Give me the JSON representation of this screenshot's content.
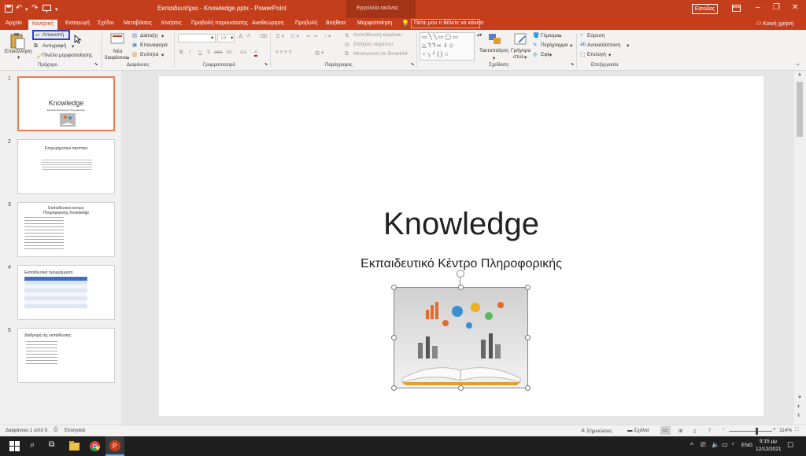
{
  "titlebar": {
    "title": "Εκπαιδευτήριο - Knowledge.pptx - PowerPoint",
    "context": "Εργαλεία εικόνας",
    "signin": "Είσοδος",
    "save_icon": "save-icon",
    "undo_icon": "undo-icon",
    "redo_icon": "redo-icon",
    "present_icon": "present-icon"
  },
  "tabs": {
    "file": "Αρχείο",
    "home": "Κεντρική",
    "insert": "Εισαγωγή",
    "design": "Σχέδιο",
    "transitions": "Μεταβάσεις",
    "animations": "Κινήσεις",
    "slideshow": "Προβολή παρουσίασης",
    "review": "Αναθεώρηση",
    "view": "Προβολή",
    "help": "Βοήθεια",
    "format": "Μορφοποίηση",
    "tellme": "Πείτε μου τι θέλετε να κάνετε",
    "share": "Κοινή χρήση"
  },
  "ribbon": {
    "clipboard": {
      "paste": "Επικόλληση",
      "cut": "Αποκοπή",
      "copy": "Αντιγραφή",
      "format_painter": "Πινέλο μορφοποίησης",
      "label": "Πρόχειρο"
    },
    "slides": {
      "new_slide_1": "Νέα",
      "new_slide_2": "διαφάνεια",
      "layout": "Διάταξη",
      "reset": "Επαναφορά",
      "section": "Ενότητα",
      "label": "Διαφάνειες"
    },
    "font": {
      "size": "18",
      "label": "Γραμματοσειρά",
      "bold": "B",
      "italic": "I",
      "underline": "U",
      "shadow": "S",
      "strike": "abc",
      "spacing": "AV",
      "case": "Aa",
      "font_color": "A",
      "grow": "A",
      "shrink": "A"
    },
    "paragraph": {
      "text_direction": "Κατεύθυνση κειμένου",
      "align_text": "Στοίχιση κειμένου",
      "smartart": "Μετατροπή σε SmartArt",
      "label": "Παράγραφος"
    },
    "drawing": {
      "arrange": "Τακτοποίηση",
      "quick_styles_1": "Γρήγορα",
      "quick_styles_2": "στυλ",
      "fill": "Γέμισμα",
      "outline": "Περίγραμμα",
      "effects": "Εφέ",
      "label": "Σχεδίαση"
    },
    "editing": {
      "find": "Εύρεση",
      "replace": "Αντικατάσταση",
      "select": "Επιλογή",
      "label": "Επεξεργασία"
    }
  },
  "thumbnails": [
    {
      "num": "1",
      "title": "Knowledge",
      "subtitle": "Εκπαιδευτικό Κέντρο Πληροφορικής"
    },
    {
      "num": "2",
      "title": "Επιχειρηματικό σκεπτικό"
    },
    {
      "num": "3",
      "title": "Εκπαιδευτικό κέντρο",
      "title2": "Πληροφορικής Knowledge"
    },
    {
      "num": "4",
      "title": "Εκπαιδευτικά προγράμματα"
    },
    {
      "num": "5",
      "title": "Διαδρομή της εκπαίδευσης"
    }
  ],
  "slide": {
    "title": "Knowledge",
    "subtitle": "Εκπαιδευτικό Κέντρο Πληροφορικής"
  },
  "status": {
    "slide_count": "Διαφάνεια 1 από 5",
    "language": "Ελληνικά",
    "notes": "Σημειώσεις",
    "comments": "Σχόλια",
    "zoom": "114%"
  },
  "taskbar": {
    "lang": "ENG",
    "time": "9:15 μμ",
    "date": "12/12/2021"
  },
  "colors": {
    "accent": "#c43e1c",
    "selection": "#f07b52"
  }
}
